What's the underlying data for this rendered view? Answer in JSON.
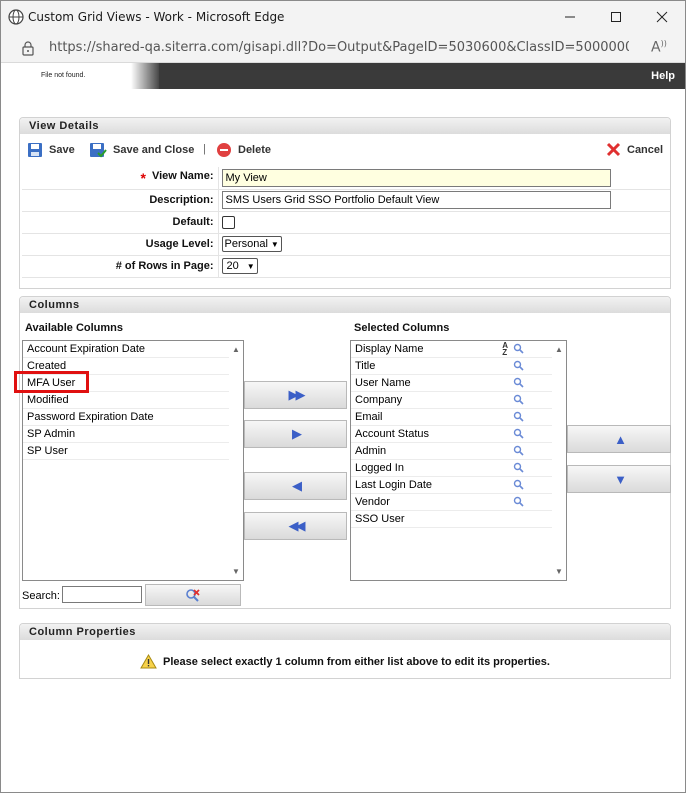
{
  "window": {
    "title": "Custom Grid Views - Work - Microsoft Edge",
    "url": "https://shared-qa.siterra.com/gisapi.dll?Do=Output&PageID=5030600&ClassID=5000000&..."
  },
  "app_header": {
    "logo_alt": "File not found.",
    "help_label": "Help"
  },
  "view_details": {
    "header": "View Details",
    "toolbar": {
      "save_label": "Save",
      "save_close_label": "Save and Close",
      "delete_label": "Delete",
      "cancel_label": "Cancel"
    },
    "fields": {
      "view_name_label": "View Name:",
      "view_name_value": "My View",
      "description_label": "Description:",
      "description_value": "SMS Users Grid SSO Portfolio Default View",
      "default_label": "Default:",
      "usage_level_label": "Usage Level:",
      "usage_level_value": "Personal",
      "rows_label": "# of Rows in Page:",
      "rows_value": "20"
    }
  },
  "columns": {
    "header": "Columns",
    "available_label": "Available Columns",
    "selected_label": "Selected Columns",
    "available": [
      "Account Expiration Date",
      "Created",
      "MFA User",
      "Modified",
      "Password Expiration Date",
      "SP Admin",
      "SP User"
    ],
    "selected": [
      "Display Name",
      "Title",
      "User Name",
      "Company",
      "Email",
      "Account Status",
      "Admin",
      "Logged In",
      "Last Login Date",
      "Vendor",
      "SSO User"
    ],
    "search_label": "Search:",
    "sort_az": "A Z"
  },
  "column_properties": {
    "header": "Column Properties",
    "message": "Please select exactly 1 column from either list above to edit its properties."
  },
  "colors": {
    "accent_blue": "#3b5fc7",
    "highlight_red": "#e01010",
    "header_dark": "#3a3a3a"
  }
}
